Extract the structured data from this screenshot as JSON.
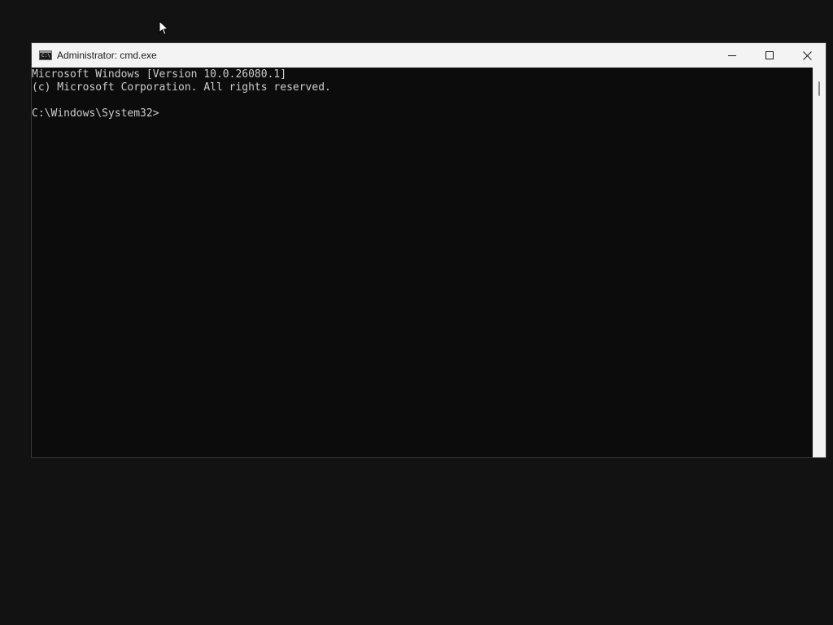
{
  "window": {
    "title": "Administrator: cmd.exe",
    "icon_label": "C:\\"
  },
  "caption_buttons": [
    {
      "name": "minimize",
      "icon": "minimize-icon"
    },
    {
      "name": "maximize",
      "icon": "maximize-icon"
    },
    {
      "name": "close",
      "icon": "close-icon"
    }
  ],
  "console": {
    "lines": [
      "Microsoft Windows [Version 10.0.26080.1]",
      "(c) Microsoft Corporation. All rights reserved.",
      "",
      "C:\\Windows\\System32>"
    ]
  },
  "colors": {
    "desktop_bg": "#121212",
    "console_bg": "#0c0c0c",
    "console_text": "#cccccc",
    "titlebar_bg": "#f3f3f3"
  }
}
